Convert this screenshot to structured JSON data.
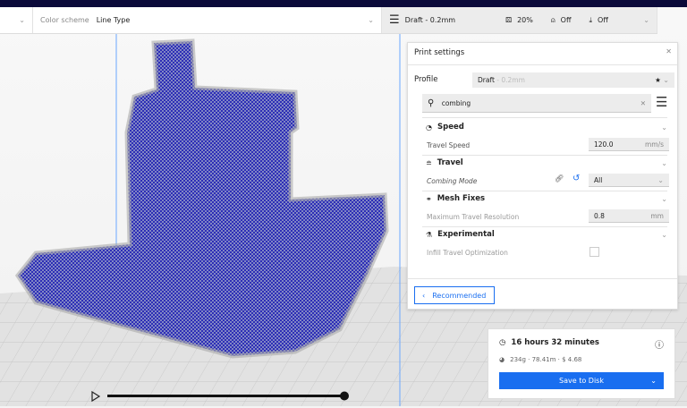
{
  "toolbar": {
    "color_scheme_label": "Color scheme",
    "color_scheme_value": "Line Type",
    "profile": "Draft - 0.2mm",
    "infill": "20%",
    "support": "Off",
    "adhesion": "Off"
  },
  "print_settings": {
    "title": "Print settings",
    "profile_label": "Profile",
    "profile_name": "Draft",
    "profile_suffix": " - 0.2mm",
    "search_value": "combing",
    "sections": [
      {
        "name": "Speed",
        "setting": "Travel Speed",
        "value": "120.0",
        "unit": "mm/s"
      },
      {
        "name": "Travel",
        "setting": "Combing Mode",
        "value": "All"
      },
      {
        "name": "Mesh Fixes",
        "setting": "Maximum Travel Resolution",
        "value": "0.8",
        "unit": "mm"
      },
      {
        "name": "Experimental",
        "setting": "Infill Travel Optimization",
        "checked": false
      }
    ],
    "recommended_button": "Recommended"
  },
  "job": {
    "time": "16 hours 32 minutes",
    "material": "234g · 78.41m · $ 4.68",
    "save_button": "Save to Disk"
  },
  "colors": {
    "accent": "#196ef0",
    "model": "#1c1cb4",
    "header": "#0b0a3a"
  }
}
